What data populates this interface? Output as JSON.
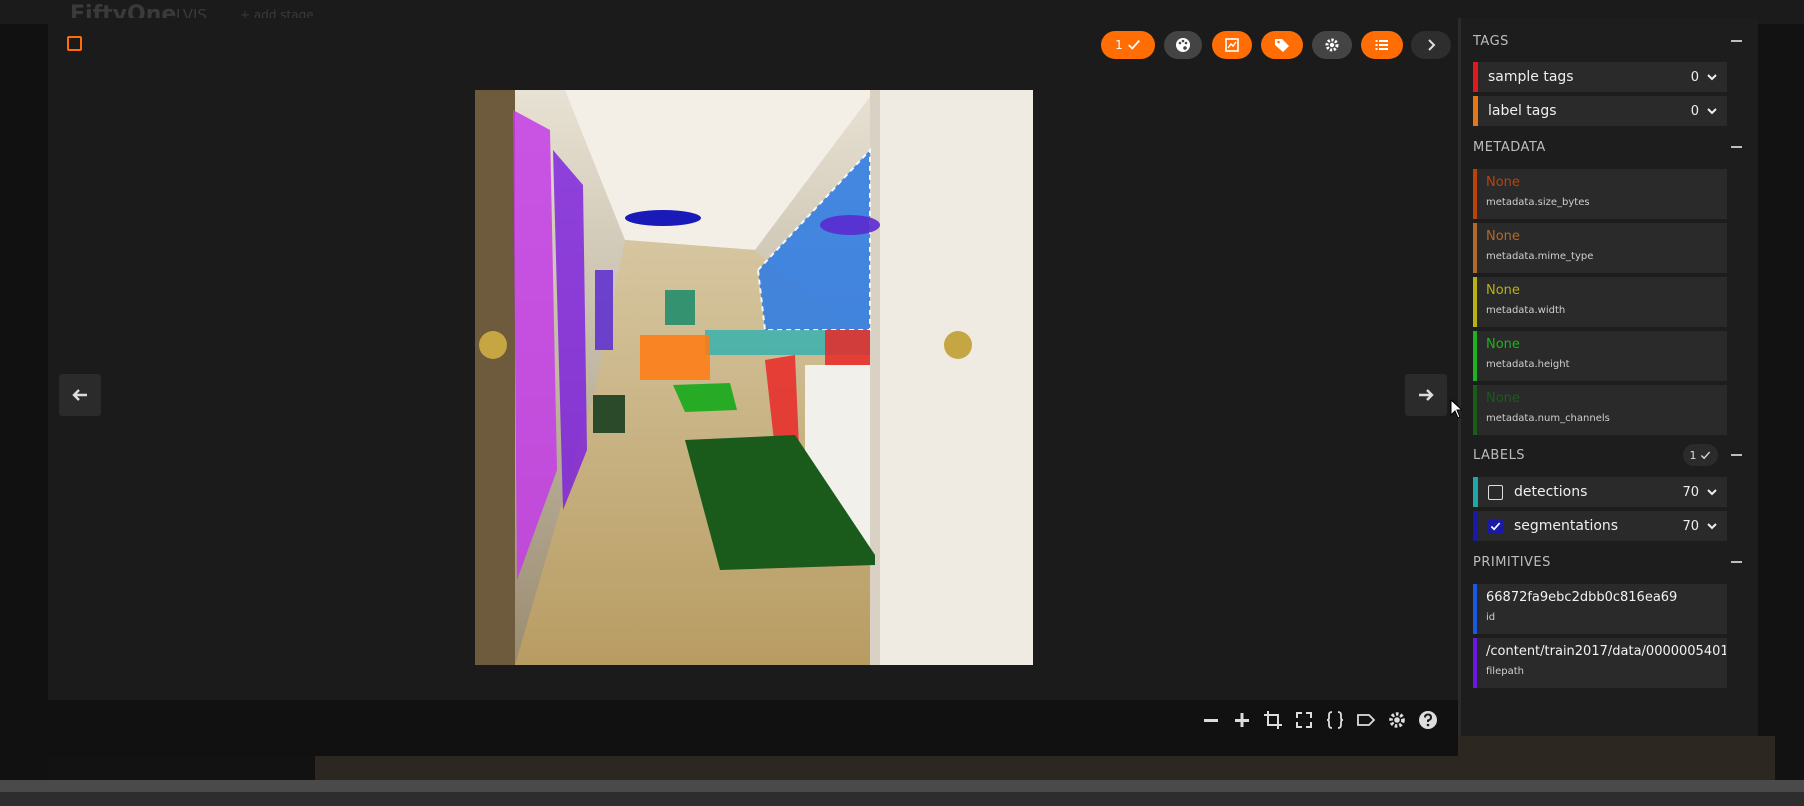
{
  "app": {
    "brand": "FiftyOne",
    "dataset": "LVIS",
    "add_stage": "+ add stage"
  },
  "modal": {
    "toolbar": {
      "selected_label": "1",
      "buttons": [
        "select-labels",
        "color-palette",
        "fullscreen",
        "tag",
        "settings",
        "sidebar-toggle",
        "next"
      ]
    },
    "colors": {
      "accent": "#ff6d04",
      "bg": "#1b1b1b"
    }
  },
  "sidebar": {
    "tags": {
      "title": "TAGS",
      "items": [
        {
          "label": "sample tags",
          "count": "0",
          "color": "#e01a1a"
        },
        {
          "label": "label tags",
          "count": "0",
          "color": "#e67616"
        }
      ]
    },
    "metadata": {
      "title": "METADATA",
      "items": [
        {
          "value": "None",
          "key": "metadata.size_bytes",
          "color": "#b8440a"
        },
        {
          "value": "None",
          "key": "metadata.mime_type",
          "color": "#b06a2e"
        },
        {
          "value": "None",
          "key": "metadata.width",
          "color": "#b9b014"
        },
        {
          "value": "None",
          "key": "metadata.height",
          "color": "#1fb21f"
        },
        {
          "value": "None",
          "key": "metadata.num_channels",
          "color": "#1a5d1a"
        }
      ]
    },
    "labels": {
      "title": "LABELS",
      "badge": "1",
      "items": [
        {
          "label": "detections",
          "count": "70",
          "checked": false,
          "color": "#1fa6a6"
        },
        {
          "label": "segmentations",
          "count": "70",
          "checked": true,
          "color": "#1a1aa8"
        }
      ]
    },
    "primitives": {
      "title": "PRIMITIVES",
      "items": [
        {
          "value": "66872fa9ebc2dbb0c816ea69",
          "key": "id",
          "color": "#1a5ae0"
        },
        {
          "value": "/content/train2017/data/0000005401...",
          "key": "filepath",
          "color": "#6a1ae0"
        }
      ]
    }
  }
}
